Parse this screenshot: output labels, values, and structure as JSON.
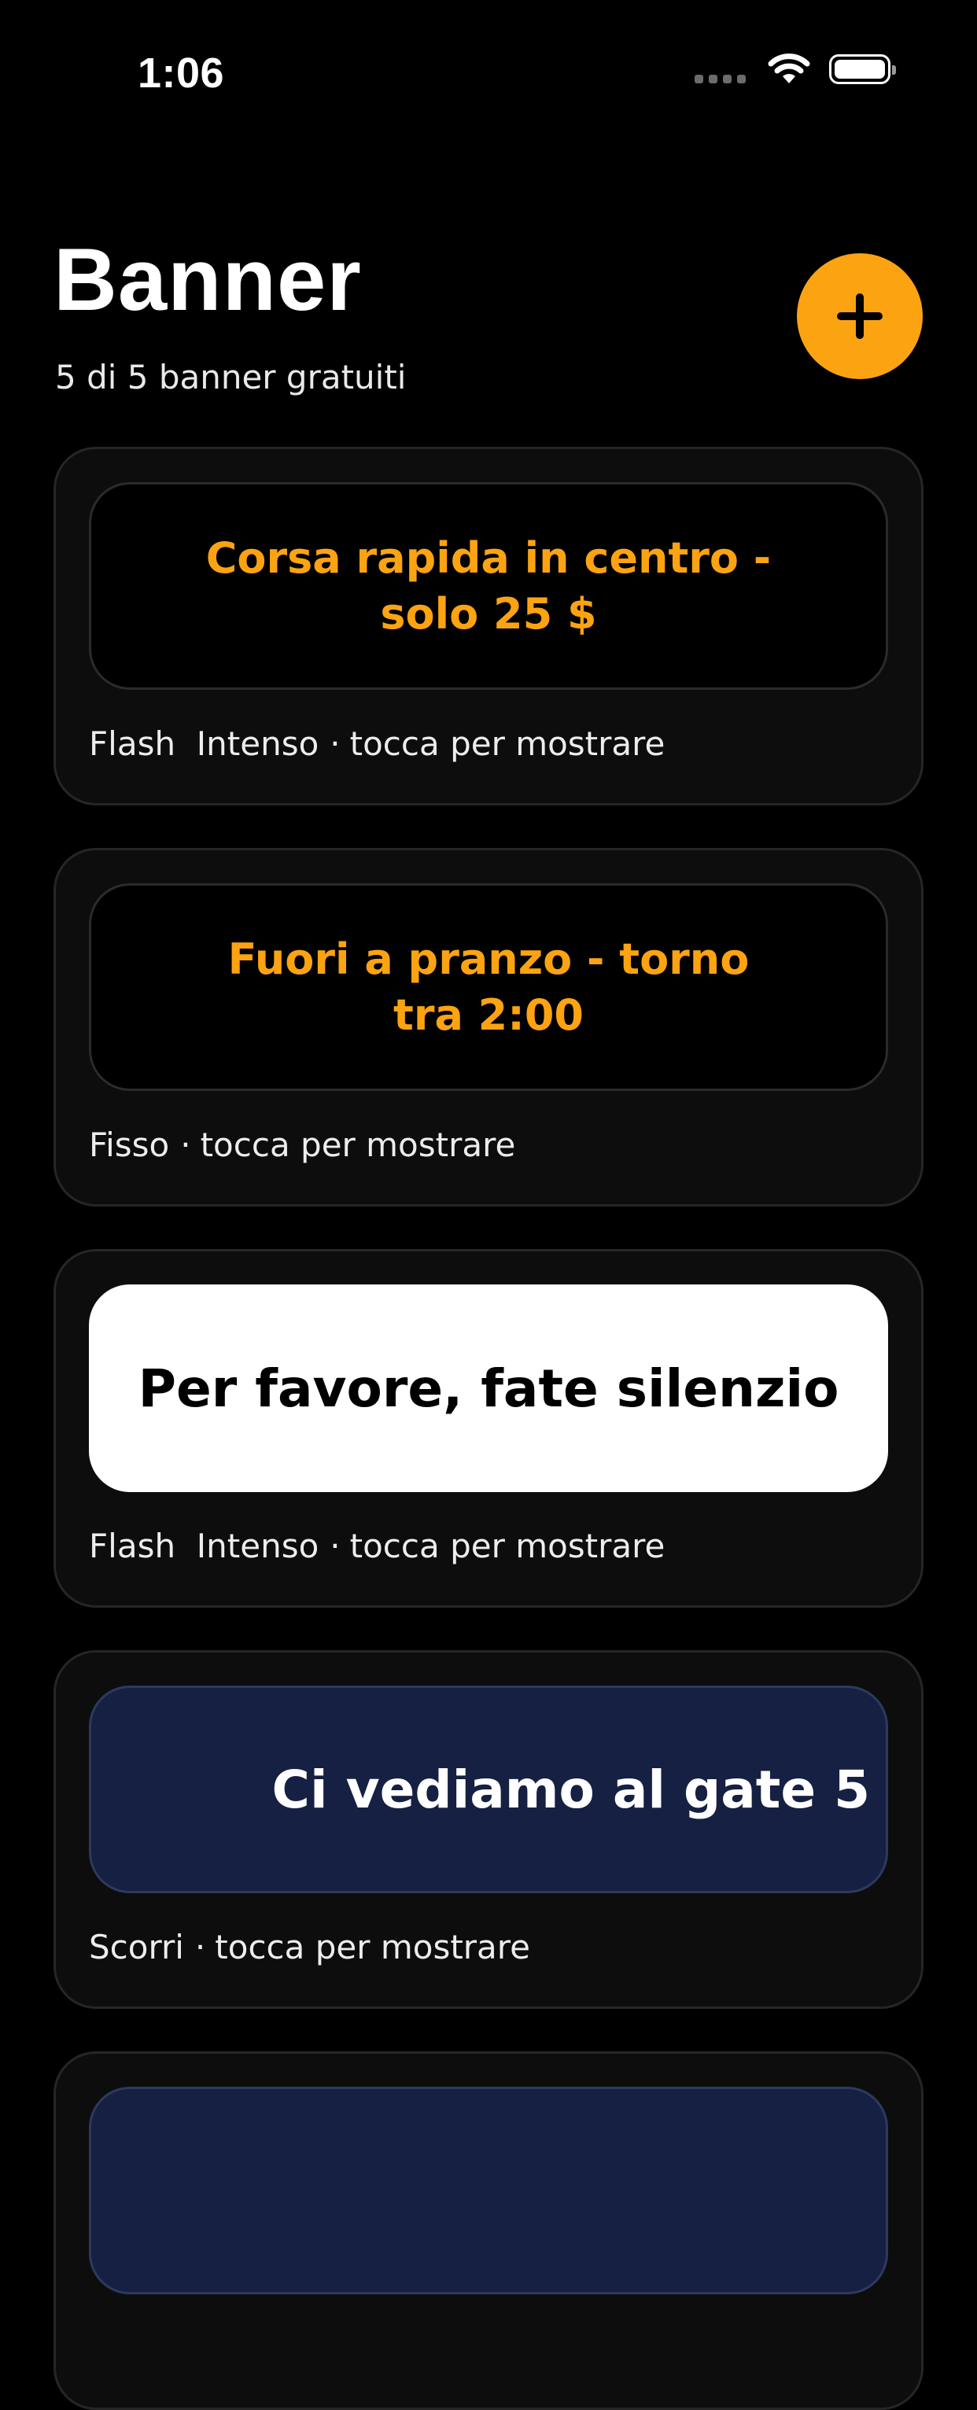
{
  "status_bar": {
    "time": "1:06",
    "icons": [
      "cellular-signal-icon",
      "wifi-icon",
      "battery-icon"
    ]
  },
  "header": {
    "title": "Banner",
    "subtitle": "5 di 5 banner gratuiti",
    "add_button_icon": "plus-icon"
  },
  "colors": {
    "accent": "#fca311",
    "background": "#000000",
    "card": "#0d0d0d",
    "navy_banner": "#152042"
  },
  "banners": [
    {
      "text": "Corsa rapida in centro - solo 25 $",
      "mode": "Flash  Intenso",
      "separator": "·",
      "hint": "tocca per mostrare",
      "style": "orange-on-black"
    },
    {
      "text": "Fuori a pranzo - torno tra 2:00",
      "mode": "Fisso",
      "separator": "·",
      "hint": "tocca per mostrare",
      "style": "orange-on-black"
    },
    {
      "text": "Per favore, fate silenzio",
      "mode": "Flash  Intenso",
      "separator": "·",
      "hint": "tocca per mostrare",
      "style": "black-on-white"
    },
    {
      "text": "Ci vediamo al gate 5",
      "mode": "Scorri",
      "separator": "·",
      "hint": "tocca per mostrare",
      "style": "white-on-navy"
    }
  ]
}
